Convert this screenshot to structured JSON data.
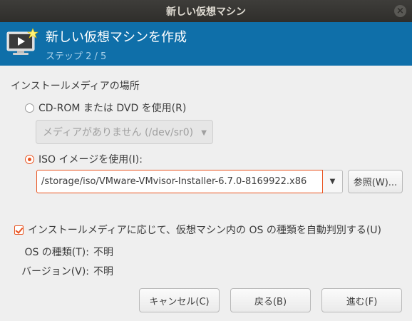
{
  "window": {
    "title": "新しい仮想マシン"
  },
  "header": {
    "title": "新しい仮想マシンを作成",
    "step": "ステップ 2 / 5"
  },
  "install_media": {
    "section_label": "インストールメディアの場所",
    "cdrom_option": "CD-ROM または DVD を使用(R)",
    "cdrom_combo_value": "メディアがありません (/dev/sr0)",
    "iso_option": "ISO イメージを使用(I):",
    "iso_path": "/storage/iso/VMware-VMvisor-Installer-6.7.0-8169922.x86",
    "browse_label": "参照(W)..."
  },
  "os_detect": {
    "auto_detect_label": "インストールメディアに応じて、仮想マシン内の OS の種類を自動判別する(U)",
    "os_type_label": "OS の種類(T):",
    "os_type_value": "不明",
    "version_label": "バージョン(V):",
    "version_value": "不明"
  },
  "buttons": {
    "cancel": "キャンセル(C)",
    "back": "戻る(B)",
    "forward": "進む(F)"
  },
  "colors": {
    "header_bg": "#0f6fa9",
    "accent": "#e9531f",
    "titlebar_bg": "#3e3d3a"
  },
  "icons": {
    "header": "vm-monitor-icon",
    "close": "close-icon",
    "dropdown": "chevron-down-icon"
  }
}
